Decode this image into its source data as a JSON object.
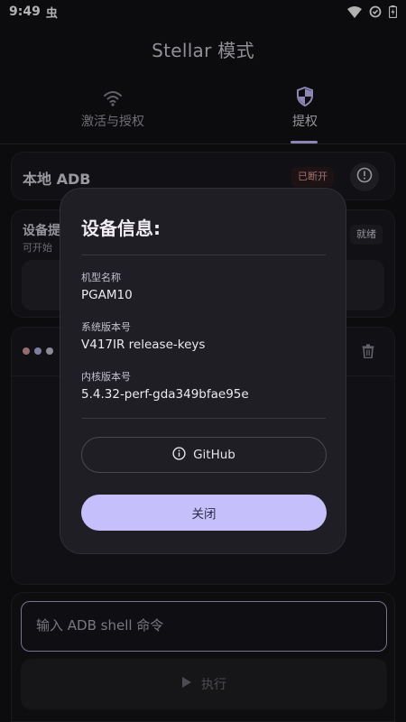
{
  "status_bar": {
    "time": "9:49",
    "notification_glyph": "虫",
    "icons": [
      "wifi-icon",
      "battery-saver-icon",
      "battery-icon"
    ]
  },
  "header": {
    "title": "Stellar 模式"
  },
  "tabs": [
    {
      "label": "激活与授权",
      "icon": "wifi-icon",
      "active": false
    },
    {
      "label": "提权",
      "icon": "shield-icon",
      "active": true
    }
  ],
  "adb_card": {
    "title": "本地 ADB",
    "status_badge": "已断开",
    "info_icon": "info-circle-icon"
  },
  "device_card": {
    "title": "设备提",
    "subtitle": "可开始",
    "status_badge": "就绪"
  },
  "log_card": {
    "dot_colors": [
      "#d49e9e",
      "#b7b2e8",
      "#c9c6d6"
    ],
    "trash_icon": "trash-icon"
  },
  "command": {
    "input_placeholder": "输入 ADB shell 命令",
    "execute_label": "执行",
    "execute_icon": "play-icon"
  },
  "dialog": {
    "title": "设备信息:",
    "fields": [
      {
        "label": "机型名称",
        "value": "PGAM10"
      },
      {
        "label": "系统版本号",
        "value": "V417IR release-keys"
      },
      {
        "label": "内核版本号",
        "value": "5.4.32-perf-gda349bfae95e"
      }
    ],
    "github_label": "GitHub",
    "close_label": "关闭"
  },
  "colors": {
    "accent": "#c5c0fb",
    "background": "#121215",
    "card": "#19181d",
    "dialog": "#1f1e24"
  }
}
